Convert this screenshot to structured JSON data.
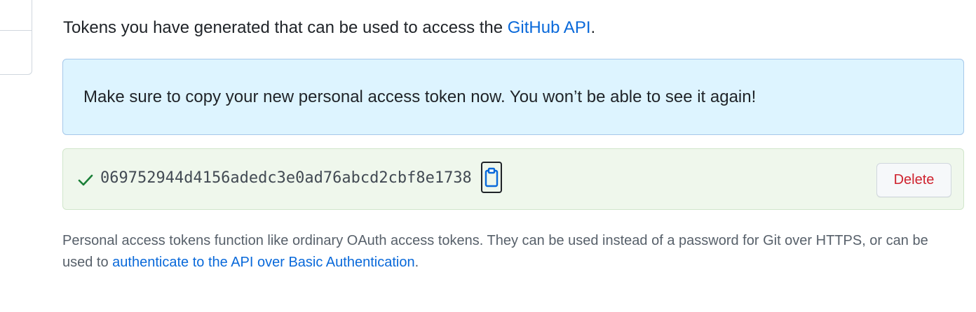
{
  "intro": {
    "text_before": "Tokens you have generated that can be used to access the ",
    "link": "GitHub API",
    "text_after": "."
  },
  "flash": {
    "message": "Make sure to copy your new personal access token now. You won’t be able to see it again!"
  },
  "token": {
    "value": "069752944d4156adedc3e0ad76abcd2cbf8e1738",
    "status_icon": "check-icon",
    "copy_icon": "clipboard-icon",
    "delete_label": "Delete"
  },
  "note": {
    "text_before": "Personal access tokens function like ordinary OAuth access tokens. They can be used instead of a password for Git over HTTPS, or can be used to ",
    "link": "authenticate to the API over Basic Authentication",
    "text_after": "."
  },
  "colors": {
    "link": "#0969da",
    "flash_bg": "#ddf4ff",
    "success_bg": "#eff7ec",
    "success_icon": "#1a7f37",
    "danger": "#cf222e"
  }
}
